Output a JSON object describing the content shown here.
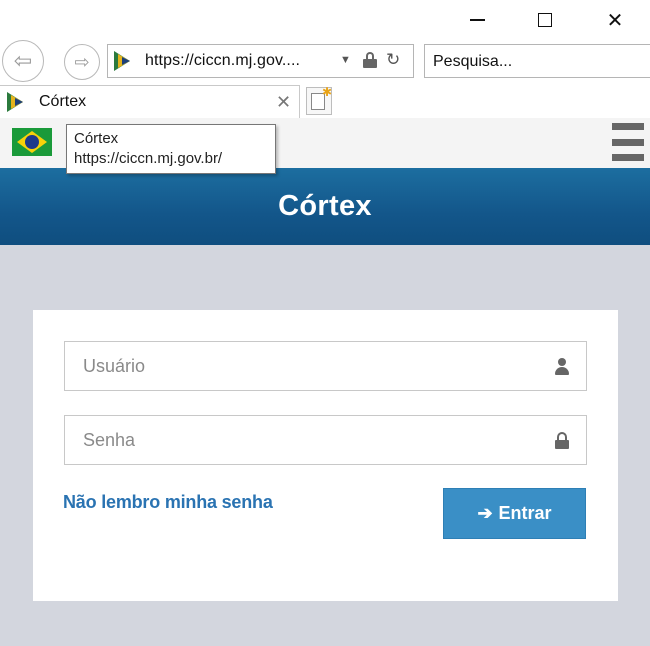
{
  "browser": {
    "url": "https://ciccn.mj.gov....",
    "search_placeholder": "Pesquisa...",
    "tab_title": "Córtex",
    "tooltip_title": "Córtex",
    "tooltip_url": "https://ciccn.mj.gov.br/"
  },
  "site": {
    "header_title": "Córtex",
    "header_color": "#13568a"
  },
  "login": {
    "username_placeholder": "Usuário",
    "password_placeholder": "Senha",
    "forgot_label": "Não lembro minha senha",
    "submit_label": "Entrar",
    "accent_color": "#3a8fc6"
  }
}
